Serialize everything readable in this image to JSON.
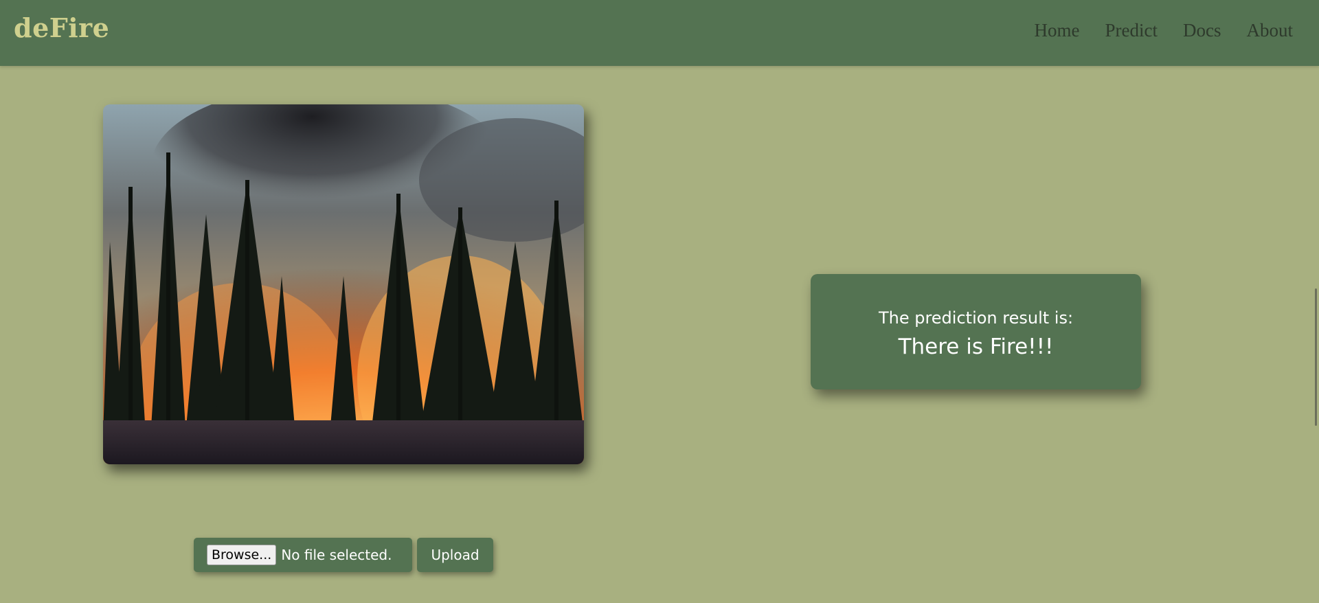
{
  "nav": {
    "brand": "deFire",
    "links": [
      {
        "label": "Home"
      },
      {
        "label": "Predict"
      },
      {
        "label": "Docs"
      },
      {
        "label": "About"
      }
    ]
  },
  "uploaded_image": {
    "subject": "forest fire"
  },
  "result": {
    "label": "The prediction result is:",
    "value": "There is Fire!!!"
  },
  "upload": {
    "browse_label": "Browse...",
    "file_status": "No file selected.",
    "upload_label": "Upload"
  },
  "colors": {
    "page_bg": "#a8b080",
    "nav_bg": "#547352",
    "brand": "#cfd08e",
    "card_bg": "#547352",
    "nav_text": "#2e3a2c"
  }
}
